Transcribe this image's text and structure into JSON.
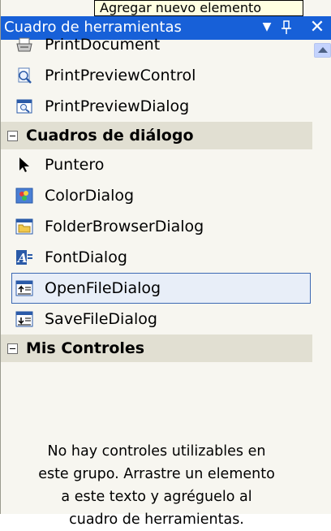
{
  "tooltip": {
    "text": "Agregar nuevo elemento"
  },
  "titlebar": {
    "title": "Cuadro de herramientas",
    "dropdown_icon": "chevron-down-icon",
    "pin_icon": "pin-icon",
    "close_icon": "close-icon"
  },
  "items_top": [
    {
      "label": "PrintDocument",
      "icon": "print-document-icon"
    },
    {
      "label": "PrintPreviewControl",
      "icon": "print-preview-control-icon"
    },
    {
      "label": "PrintPreviewDialog",
      "icon": "print-preview-dialog-icon"
    }
  ],
  "groups": [
    {
      "label": "Cuadros de diálogo",
      "items": [
        {
          "label": "Puntero",
          "icon": "pointer-icon"
        },
        {
          "label": "ColorDialog",
          "icon": "color-dialog-icon"
        },
        {
          "label": "FolderBrowserDialog",
          "icon": "folder-browser-dialog-icon"
        },
        {
          "label": "FontDialog",
          "icon": "font-dialog-icon"
        },
        {
          "label": "OpenFileDialog",
          "icon": "open-file-dialog-icon",
          "selected": true
        },
        {
          "label": "SaveFileDialog",
          "icon": "save-file-dialog-icon"
        }
      ]
    },
    {
      "label": "Mis Controles",
      "items": []
    }
  ],
  "empty_message": {
    "line1": "No hay controles utilizables en",
    "line2": "este grupo. Arrastre un elemento",
    "line3": "a este texto y agréguelo al",
    "line4": "cuadro de herramientas."
  },
  "colors": {
    "titlebar": "#1760d8",
    "panel": "#f7f6f0",
    "group_header": "#e1dfd2",
    "selection_border": "#3d69b3",
    "tooltip_bg": "#ffffe1"
  }
}
